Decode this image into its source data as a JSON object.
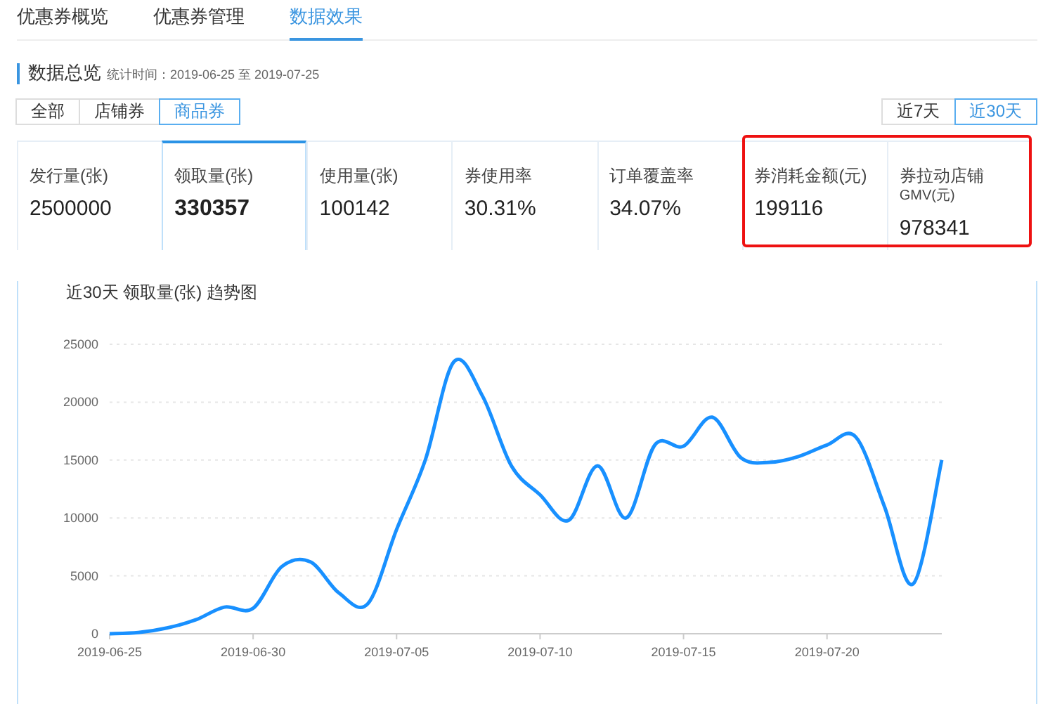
{
  "tabs": [
    {
      "label": "优惠券概览",
      "selected": false
    },
    {
      "label": "优惠券管理",
      "selected": false
    },
    {
      "label": "数据效果",
      "selected": true
    }
  ],
  "overview": {
    "title": "数据总览",
    "period": "统计时间：2019-06-25 至 2019-07-25"
  },
  "type_filter": [
    {
      "label": "全部",
      "selected": false
    },
    {
      "label": "店铺券",
      "selected": false
    },
    {
      "label": "商品券",
      "selected": true
    }
  ],
  "range_filter": [
    {
      "label": "近7天",
      "selected": false
    },
    {
      "label": "近30天",
      "selected": true
    }
  ],
  "metrics": [
    {
      "label": "发行量(张)",
      "value": "2500000",
      "selected": false,
      "highlighted": false
    },
    {
      "label": "领取量(张)",
      "value": "330357",
      "selected": true,
      "highlighted": false
    },
    {
      "label": "使用量(张)",
      "value": "100142",
      "selected": false,
      "highlighted": false
    },
    {
      "label": "券使用率",
      "value": "30.31%",
      "selected": false,
      "highlighted": false
    },
    {
      "label": "订单覆盖率",
      "value": "34.07%",
      "selected": false,
      "highlighted": false
    },
    {
      "label": "券消耗金额(元)",
      "value": "199116",
      "selected": false,
      "highlighted": true
    },
    {
      "label": "券拉动店铺",
      "sublabel": "GMV(元)",
      "value": "978341",
      "selected": false,
      "highlighted": true
    }
  ],
  "chart": {
    "chart_data": {
      "type": "line",
      "title": "近30天 领取量(张) 趋势图",
      "categories": [
        "2019-06-25",
        null,
        null,
        null,
        null,
        "2019-06-30",
        null,
        null,
        null,
        null,
        "2019-07-05",
        null,
        null,
        null,
        null,
        "2019-07-10",
        null,
        null,
        null,
        null,
        "2019-07-15",
        null,
        null,
        null,
        null,
        "2019-07-20",
        null,
        null,
        null,
        null
      ],
      "grid": true,
      "series": [
        {
          "color": "#1890ff",
          "values": [
            0,
            100,
            500,
            1200,
            2300,
            2200,
            5800,
            6200,
            3500,
            2600,
            9000,
            15000,
            23500,
            20500,
            14500,
            12000,
            9800,
            14500,
            10000,
            16300,
            16200,
            18700,
            15200,
            14800,
            15300,
            16300,
            17000,
            11000,
            4300,
            15000
          ]
        }
      ],
      "ylim": [
        0,
        25000
      ],
      "yticks": [
        0,
        5000,
        10000,
        15000,
        20000,
        25000
      ]
    }
  }
}
